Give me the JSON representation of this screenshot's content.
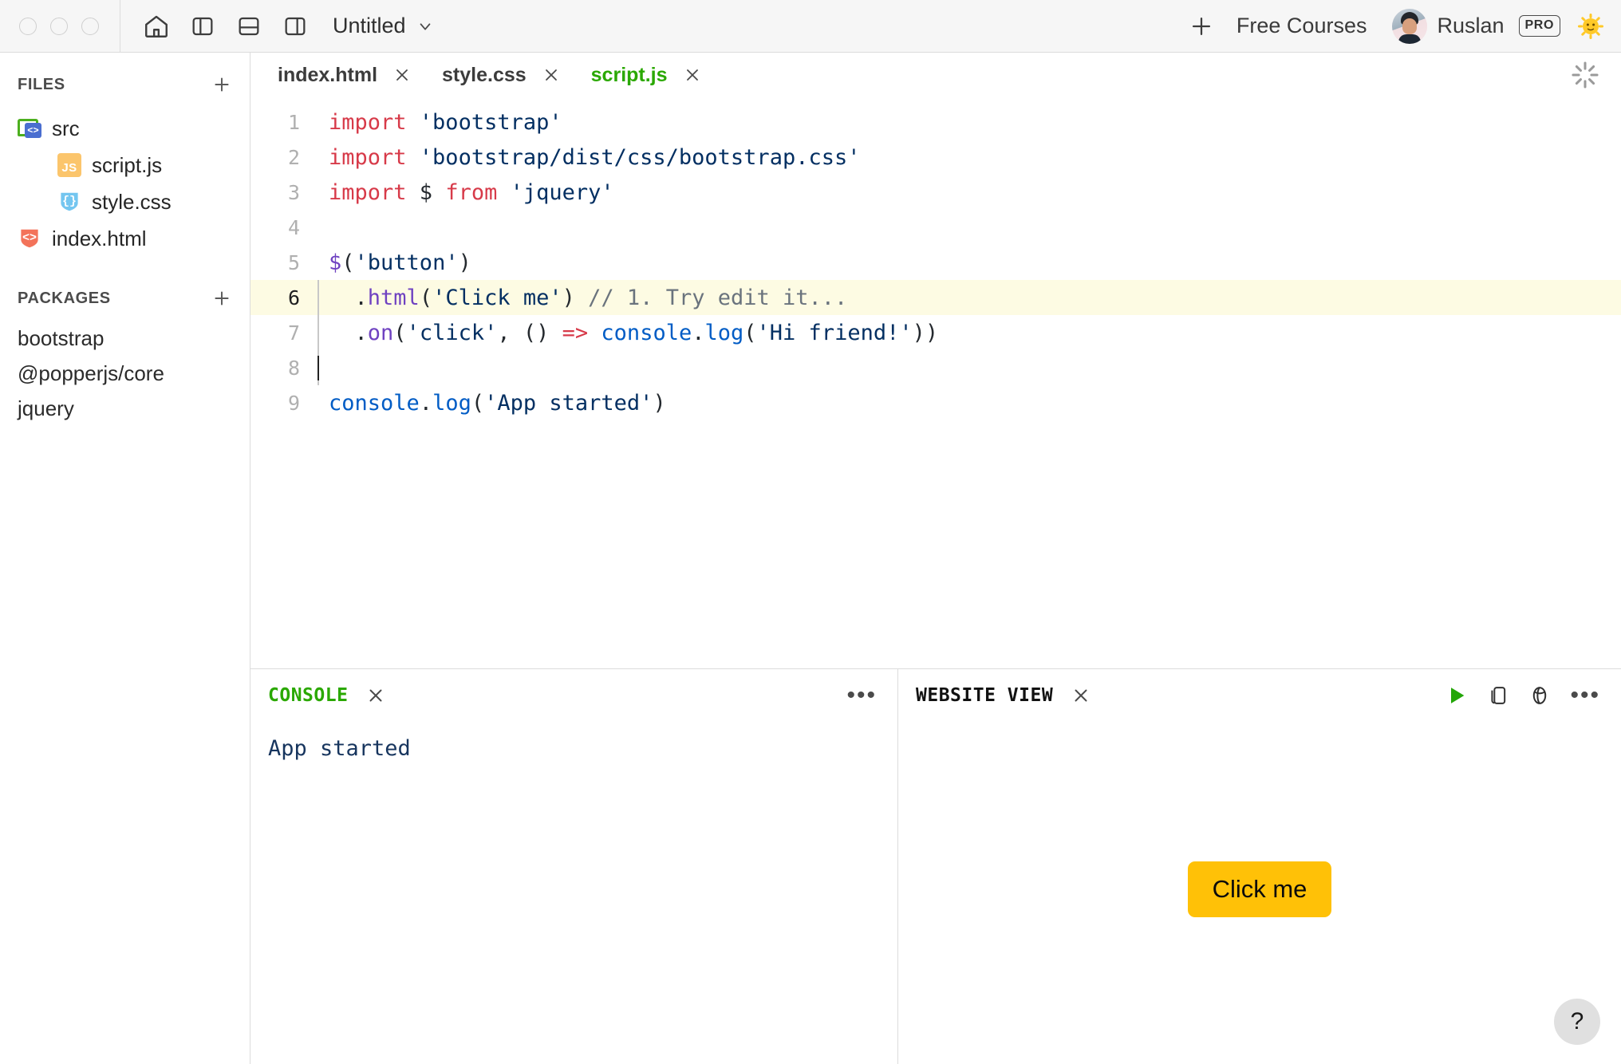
{
  "titlebar": {
    "window_controls": [
      "close",
      "minimize",
      "maximize"
    ],
    "home_icon": "home-icon",
    "layout_icons": [
      "panel-left-icon",
      "panel-bottom-icon",
      "panel-right-icon"
    ],
    "document_title": "Untitled",
    "document_chevron": "chevron-down-icon",
    "new_label": "+",
    "free_courses_label": "Free Courses",
    "user_name": "Ruslan",
    "pro_badge": "PRO",
    "theme_emoji": "☀"
  },
  "sidebar": {
    "files": {
      "title": "FILES",
      "add_label": "+",
      "items": [
        {
          "label": "src",
          "icon": "folder-src-icon",
          "indent": 0,
          "icon_text": "<>"
        },
        {
          "label": "script.js",
          "icon": "js-file-icon",
          "indent": 1,
          "icon_text": "JS"
        },
        {
          "label": "style.css",
          "icon": "css-file-icon",
          "indent": 1,
          "icon_text": "{}"
        },
        {
          "label": "index.html",
          "icon": "html-file-icon",
          "indent": 0,
          "icon_text": "<>"
        }
      ]
    },
    "packages": {
      "title": "PACKAGES",
      "add_label": "+",
      "items": [
        {
          "label": "bootstrap"
        },
        {
          "label": "@popperjs/core"
        },
        {
          "label": "jquery"
        }
      ]
    }
  },
  "editor": {
    "tabs": [
      {
        "label": "index.html",
        "active": false
      },
      {
        "label": "style.css",
        "active": false
      },
      {
        "label": "script.js",
        "active": true
      }
    ],
    "close_glyph": "×",
    "spinner_icon": "loading-spinner-icon",
    "highlighted_line": 6,
    "lines": [
      {
        "n": "1",
        "tokens": [
          {
            "t": "import ",
            "c": "kw"
          },
          {
            "t": "'bootstrap'",
            "c": "str"
          }
        ]
      },
      {
        "n": "2",
        "tokens": [
          {
            "t": "import ",
            "c": "kw"
          },
          {
            "t": "'bootstrap/dist/css/bootstrap.css'",
            "c": "str"
          }
        ]
      },
      {
        "n": "3",
        "tokens": [
          {
            "t": "import ",
            "c": "kw"
          },
          {
            "t": "$",
            "c": "pct"
          },
          {
            "t": " from ",
            "c": "kw"
          },
          {
            "t": "'jquery'",
            "c": "str"
          }
        ]
      },
      {
        "n": "4",
        "tokens": []
      },
      {
        "n": "5",
        "tokens": [
          {
            "t": "$",
            "c": "fn"
          },
          {
            "t": "(",
            "c": "pct"
          },
          {
            "t": "'button'",
            "c": "str"
          },
          {
            "t": ")",
            "c": "pct"
          }
        ]
      },
      {
        "n": "6",
        "tokens": [
          {
            "t": "  .",
            "c": "pct"
          },
          {
            "t": "html",
            "c": "fn"
          },
          {
            "t": "(",
            "c": "pct"
          },
          {
            "t": "'Click me'",
            "c": "str"
          },
          {
            "t": ") ",
            "c": "pct"
          },
          {
            "t": "// 1. Try edit it...",
            "c": "cmt"
          }
        ]
      },
      {
        "n": "7",
        "tokens": [
          {
            "t": "  .",
            "c": "pct"
          },
          {
            "t": "on",
            "c": "fn"
          },
          {
            "t": "(",
            "c": "pct"
          },
          {
            "t": "'click'",
            "c": "str"
          },
          {
            "t": ", () ",
            "c": "pct"
          },
          {
            "t": "=>",
            "c": "arrow"
          },
          {
            "t": " ",
            "c": "pct"
          },
          {
            "t": "console",
            "c": "obj"
          },
          {
            "t": ".",
            "c": "pct"
          },
          {
            "t": "log",
            "c": "obj"
          },
          {
            "t": "(",
            "c": "pct"
          },
          {
            "t": "'Hi friend!'",
            "c": "str"
          },
          {
            "t": "))",
            "c": "pct"
          }
        ]
      },
      {
        "n": "8",
        "tokens": []
      },
      {
        "n": "9",
        "tokens": [
          {
            "t": "console",
            "c": "obj"
          },
          {
            "t": ".",
            "c": "pct"
          },
          {
            "t": "log",
            "c": "obj"
          },
          {
            "t": "(",
            "c": "pct"
          },
          {
            "t": "'App started'",
            "c": "str"
          },
          {
            "t": ")",
            "c": "pct"
          }
        ]
      }
    ]
  },
  "console_panel": {
    "title": "CONSOLE",
    "close_glyph": "×",
    "menu_glyph": "•••",
    "output": [
      "App started"
    ]
  },
  "website_panel": {
    "title": "WEBSITE VIEW",
    "close_glyph": "×",
    "actions": [
      "run-icon",
      "copy-icon",
      "open-external-icon",
      "more-icon"
    ],
    "menu_glyph": "•••",
    "button_label": "Click me",
    "button_color": "#ffc107",
    "help_label": "?"
  },
  "colors": {
    "accent_green": "#2aa800",
    "keyword_red": "#d73a49",
    "string_navy": "#032f62",
    "function_purple": "#6f42c1",
    "object_blue": "#005cc5",
    "comment_gray": "#6a737d",
    "highlight_yellow": "#fdfbe3"
  }
}
